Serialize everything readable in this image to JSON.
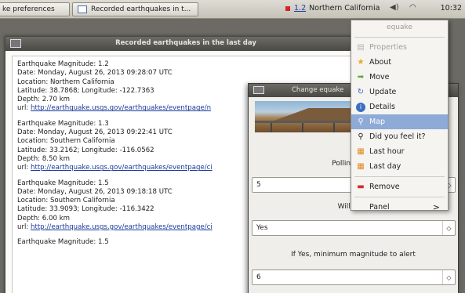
{
  "panel": {
    "tasks": [
      {
        "label": "ke preferences"
      },
      {
        "label": "Recorded earthquakes in t..."
      }
    ],
    "indicator": {
      "magnitude": "1.2",
      "region": "Northern California"
    },
    "clock": "10:32"
  },
  "main_window": {
    "title": "Recorded earthquakes in the last day",
    "entries": [
      {
        "magnitude": "Earthquake Magnitude: 1.2",
        "date": "Date: Monday, August 26, 2013 09:28:07 UTC",
        "location": "Location: Northern California",
        "latlon": "Latitude: 38.7868; Longitude: -122.7363",
        "depth": "Depth: 2.70 km",
        "url_label": "url:",
        "url": "http://earthquake.usgs.gov/earthquakes/eventpage/n"
      },
      {
        "magnitude": "Earthquake Magnitude: 1.3",
        "date": "Date: Monday, August 26, 2013 09:22:41 UTC",
        "location": "Location: Southern California",
        "latlon": "Latitude: 33.2162; Longitude: -116.0562",
        "depth": "Depth: 8.50 km",
        "url_label": "url:",
        "url": "http://earthquake.usgs.gov/earthquakes/eventpage/ci"
      },
      {
        "magnitude": "Earthquake Magnitude: 1.5",
        "date": "Date: Monday, August 26, 2013 09:18:18 UTC",
        "location": "Location: Southern California",
        "latlon": "Latitude: 33.9093; Longitude: -116.3422",
        "depth": "Depth: 6.00 km",
        "url_label": "url:",
        "url": "http://earthquake.usgs.gov/earthquakes/eventpage/ci"
      },
      {
        "magnitude": "Earthquake Magnitude: 1.5",
        "date": "",
        "location": "",
        "latlon": "",
        "depth": "",
        "url_label": "",
        "url": ""
      }
    ]
  },
  "pref_window": {
    "title": "Change equake",
    "polling_label": "Polling Time",
    "polling_value": "5",
    "alert_label": "Will alert",
    "alert_value": "Yes",
    "min_mag_label": "If Yes, minimum magnitude to alert",
    "min_mag_value": "6"
  },
  "menu": {
    "header": "equake",
    "items": [
      {
        "label": "Properties",
        "icon": "properties-icon"
      },
      {
        "label": "About",
        "icon": "star-icon"
      },
      {
        "label": "Move",
        "icon": "arrow-icon"
      },
      {
        "label": "Update",
        "icon": "refresh-icon"
      },
      {
        "label": "Details",
        "icon": "info-icon"
      },
      {
        "label": "Map",
        "icon": "search-icon"
      },
      {
        "label": "Did you feel it?",
        "icon": "search-icon"
      },
      {
        "label": "Last hour",
        "icon": "calendar-icon"
      },
      {
        "label": "Last day",
        "icon": "calendar-icon"
      },
      {
        "label": "Remove",
        "icon": "remove-icon"
      },
      {
        "label": "Panel",
        "icon": "submenu-arrow-icon"
      }
    ]
  }
}
